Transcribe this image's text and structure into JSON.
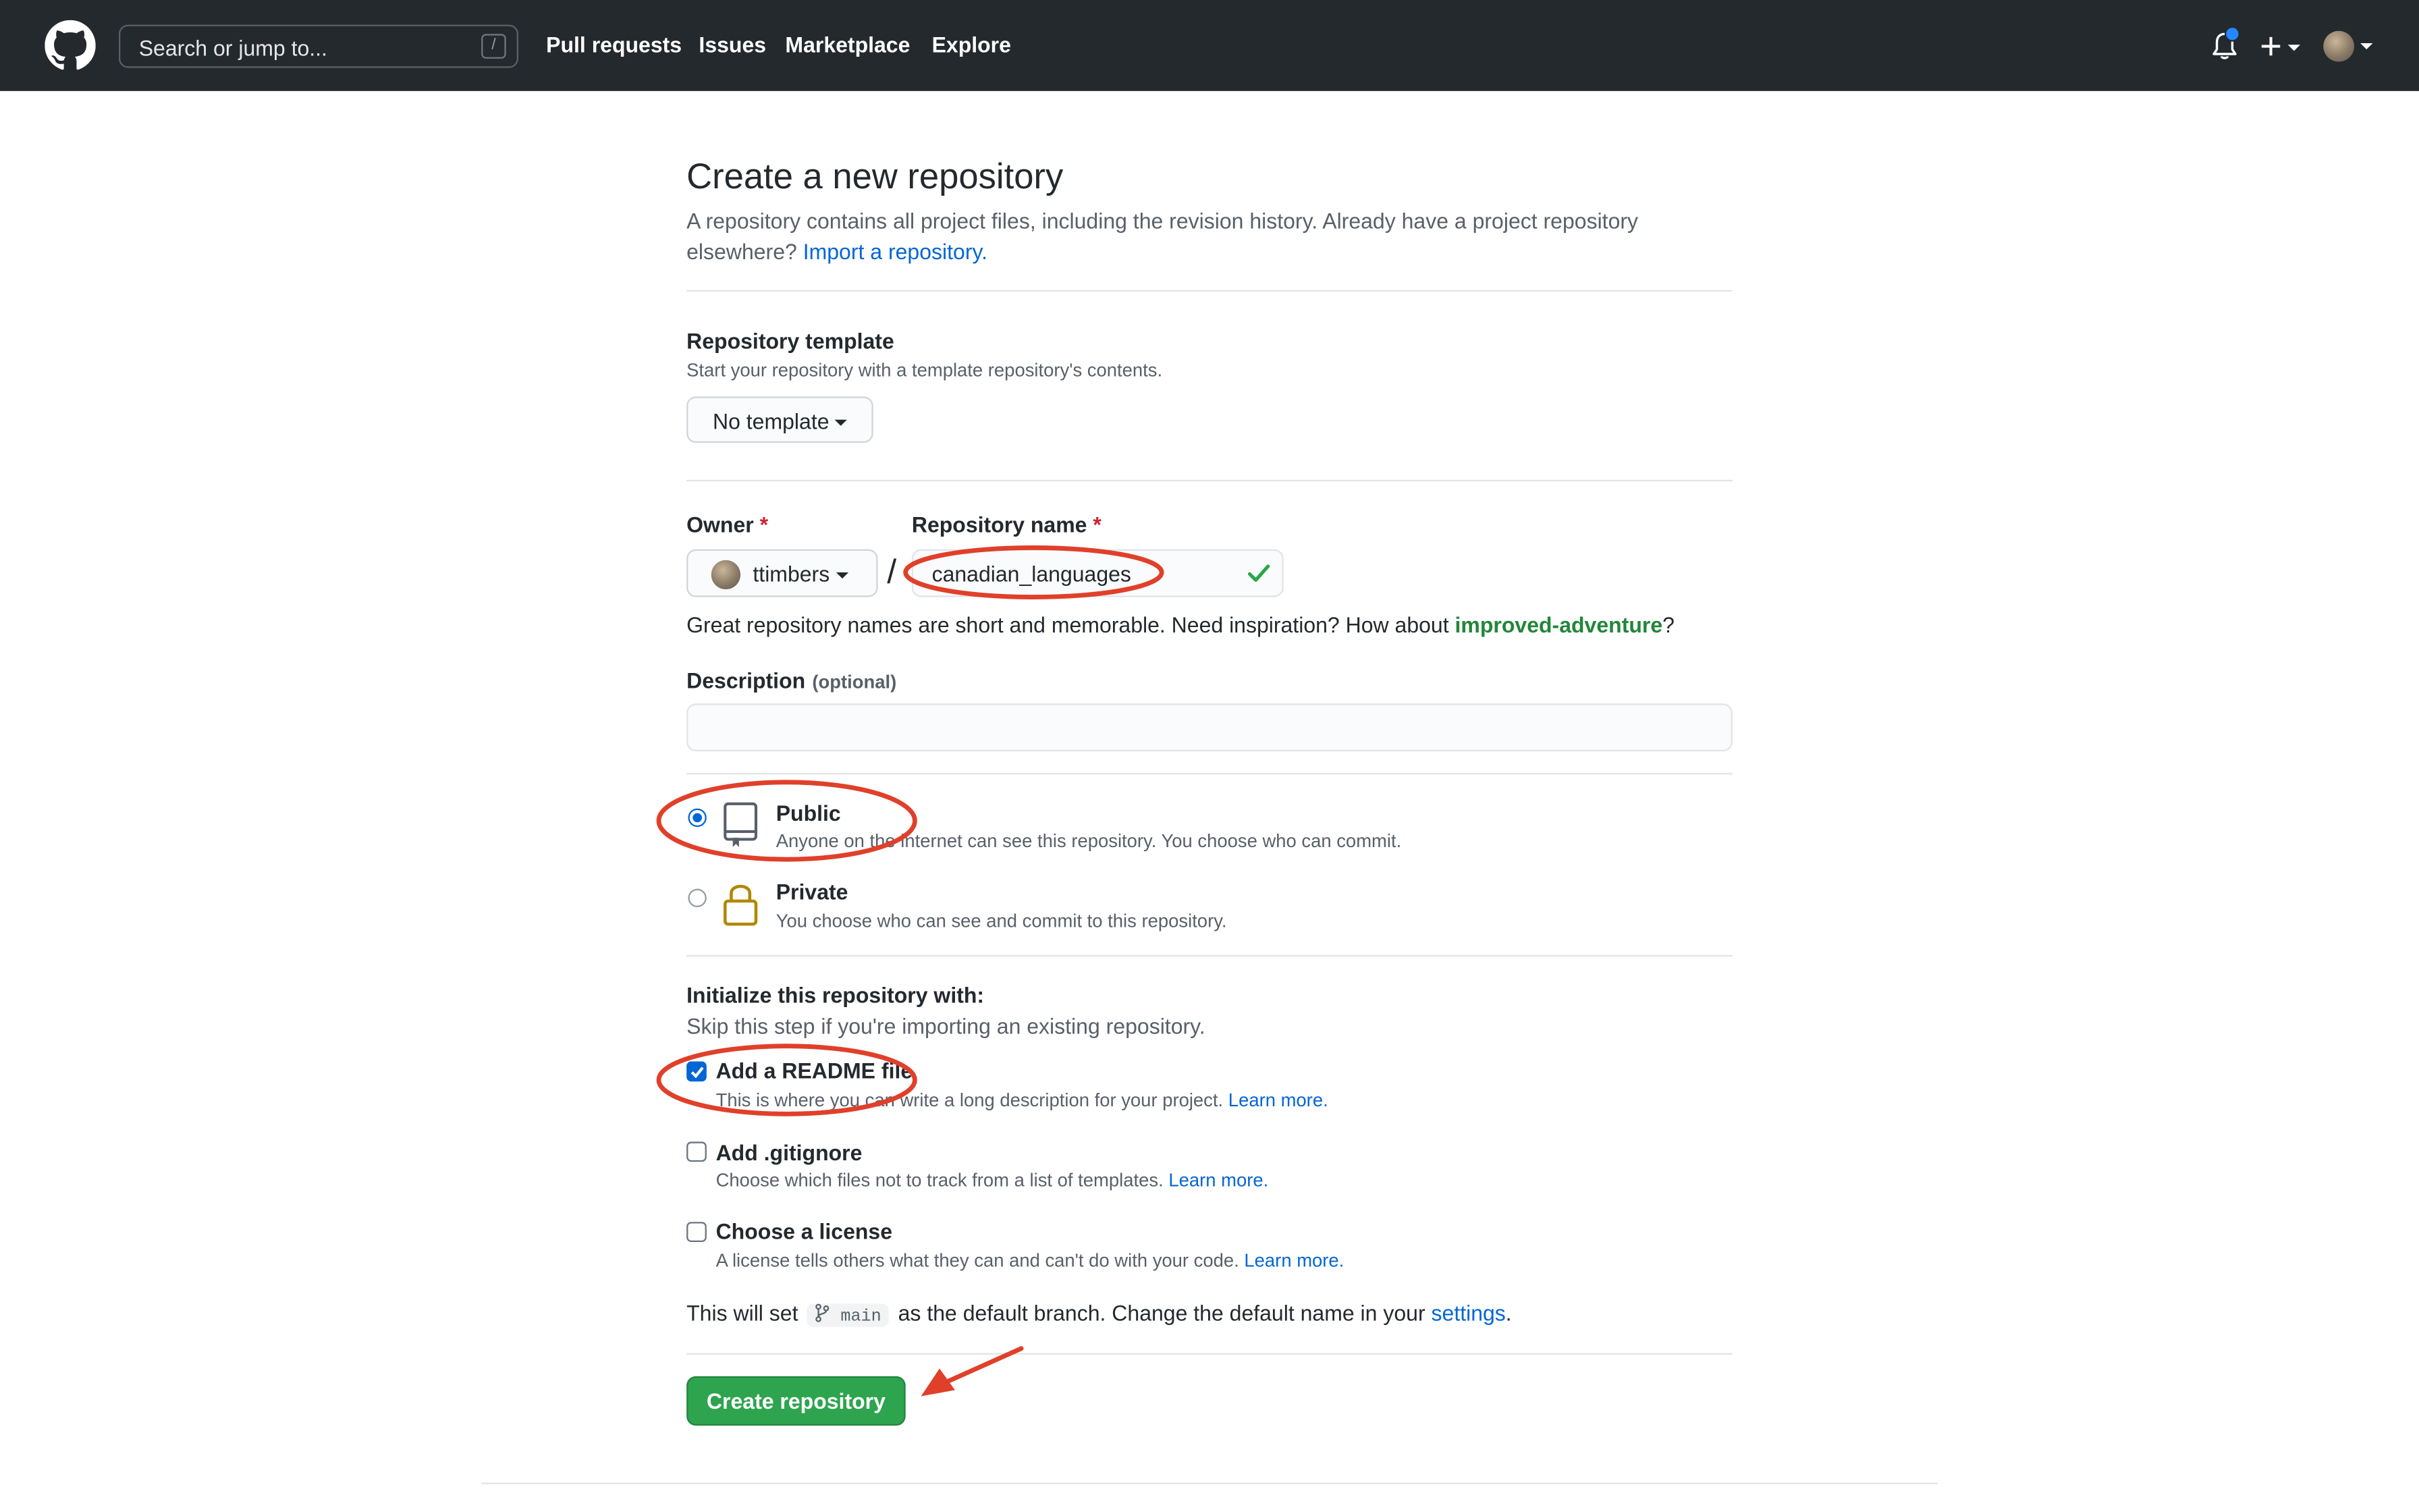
{
  "header": {
    "search_placeholder": "Search or jump to...",
    "search_shortcut": "/",
    "nav": [
      "Pull requests",
      "Issues",
      "Marketplace",
      "Explore"
    ]
  },
  "page": {
    "title": "Create a new repository",
    "intro_text": "A repository contains all project files, including the revision history. Already have a project repository elsewhere?",
    "import_link": "Import a repository."
  },
  "template": {
    "label": "Repository template",
    "help": "Start your repository with a template repository's contents.",
    "button": "No template"
  },
  "owner": {
    "label": "Owner",
    "required_mark": "*",
    "value": "ttimbers"
  },
  "separator": "/",
  "repo_name": {
    "label": "Repository name",
    "required_mark": "*",
    "value": "canadian_languages",
    "hint_prefix": "Great repository names are short and memorable. Need inspiration? How about",
    "suggestion": "improved-adventure",
    "hint_suffix": "?"
  },
  "description": {
    "label": "Description",
    "optional": "(optional)",
    "value": ""
  },
  "visibility": {
    "options": [
      {
        "label": "Public",
        "desc": "Anyone on the internet can see this repository. You choose who can commit.",
        "selected": true
      },
      {
        "label": "Private",
        "desc": "You choose who can see and commit to this repository.",
        "selected": false
      }
    ]
  },
  "init": {
    "title": "Initialize this repository with:",
    "subtitle": "Skip this step if you're importing an existing repository.",
    "options": [
      {
        "label": "Add a README file",
        "desc": "This is where you can write a long description for your project.",
        "link": "Learn more.",
        "checked": true
      },
      {
        "label": "Add .gitignore",
        "desc": "Choose which files not to track from a list of templates.",
        "link": "Learn more.",
        "checked": false
      },
      {
        "label": "Choose a license",
        "desc": "A license tells others what they can and can't do with your code.",
        "link": "Learn more.",
        "checked": false
      }
    ]
  },
  "branch_note": {
    "prefix": "This will set",
    "branch": "main",
    "middle": "as the default branch. Change the default name in your",
    "link": "settings",
    "suffix": "."
  },
  "submit": {
    "label": "Create repository"
  },
  "colors": {
    "header_bg": "#24292e",
    "link": "#0366d6",
    "primary_button": "#2ea44f",
    "suggestion": "#22863a",
    "annotation": "#e0402a",
    "notification_dot": "#2188ff"
  }
}
